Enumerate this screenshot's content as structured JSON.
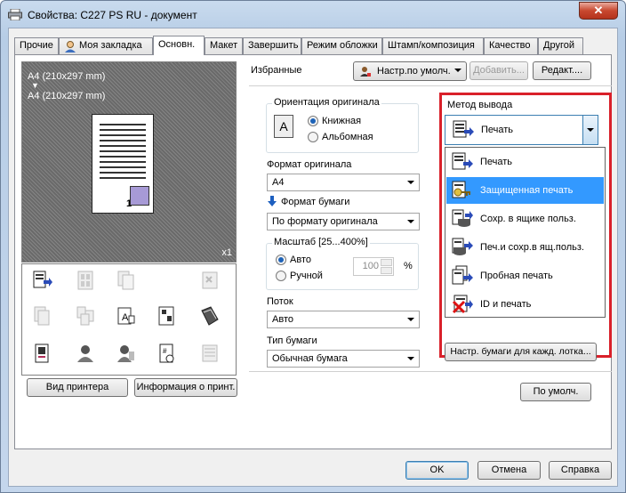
{
  "window": {
    "title": "Свойства: C227 PS RU - документ",
    "close_label": "✕"
  },
  "tabs": [
    "Прочие",
    "Моя закладка",
    "Основн.",
    "Макет",
    "Завершить",
    "Режим обложки",
    "Штамп/композиция",
    "Качество",
    "Другой"
  ],
  "active_tab": "Основн.",
  "preview": {
    "size_label_1": "A4 (210x297 mm)",
    "arrow": "▼",
    "size_label_2": "A4 (210x297 mm)",
    "page_number": "1",
    "copies": "x1"
  },
  "left_buttons": {
    "printer_view": "Вид принтера",
    "printer_info": "Информация о принт."
  },
  "favorites": {
    "label": "Избранные",
    "value": "Настр.по умолч.",
    "add": "Добавить...",
    "edit": "Редакт...."
  },
  "orientation": {
    "label": "Ориентация оригинала",
    "icon_letter": "A",
    "portrait": "Книжная",
    "landscape": "Альбомная",
    "selected": "portrait"
  },
  "original_size": {
    "label": "Формат оригинала",
    "value": "A4"
  },
  "paper_size": {
    "label": "Формат бумаги",
    "value": "По формату оригинала"
  },
  "zoom": {
    "label": "Масштаб [25...400%]",
    "auto": "Авто",
    "manual": "Ручной",
    "selected": "auto",
    "value": "100",
    "unit": "%"
  },
  "tray": {
    "label": "Поток",
    "value": "Авто"
  },
  "paper_type": {
    "label": "Тип бумаги",
    "value": "Обычная бумага"
  },
  "output_method": {
    "label": "Метод вывода",
    "value": "Печать",
    "options": [
      "Печать",
      "Защищенная печать",
      "Сохр. в ящике польз.",
      "Печ.и сохр.в ящ.польз.",
      "Пробная печать",
      "ID и печать"
    ],
    "highlighted": "Защищенная печать"
  },
  "tray_settings_button": "Настр. бумаги для кажд. лотка...",
  "defaults_button": "По умолч.",
  "footer": {
    "ok": "OK",
    "cancel": "Отмена",
    "help": "Справка"
  },
  "colors": {
    "accent": "#3399ff",
    "highlight_frame": "#d9202a",
    "title_bar": "#c4d6ec"
  }
}
